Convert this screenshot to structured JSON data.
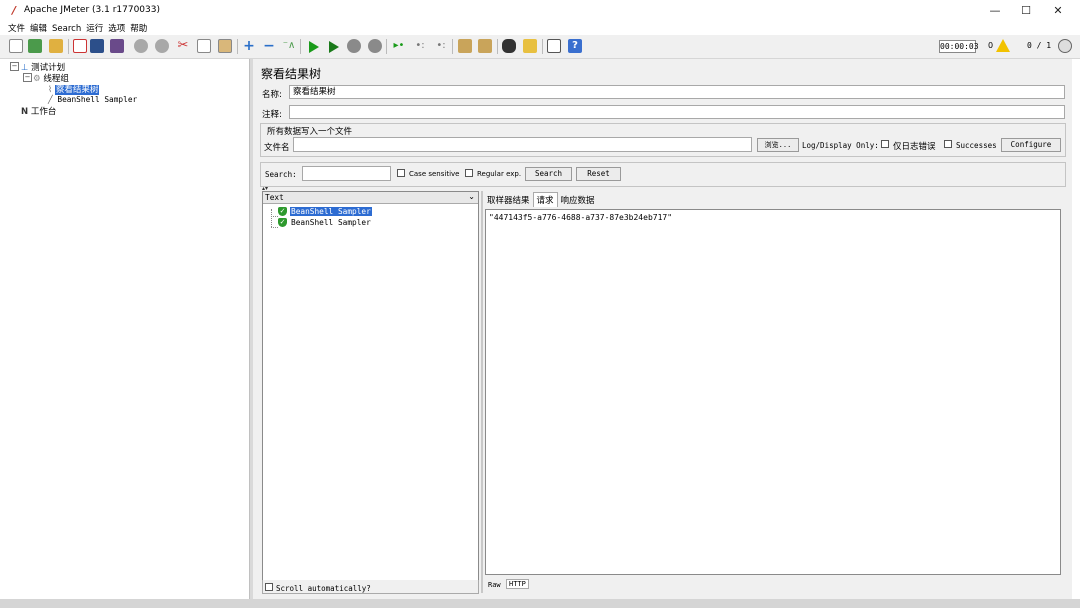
{
  "window": {
    "title": "Apache JMeter (3.1 r1770033)",
    "controls": {
      "minimize": "—",
      "maximize": "☐",
      "close": "✕"
    }
  },
  "menu": [
    "文件",
    "编辑",
    "Search",
    "运行",
    "选项",
    "帮助"
  ],
  "toolbar": {
    "timer": "00:00:03",
    "warning_count": "0",
    "threads": "0 / 1",
    "icons": [
      "new-icon",
      "templates-icon",
      "open-icon",
      "close-icon",
      "save-icon",
      "save-as-icon",
      "undo-icon",
      "redo-icon",
      "cut-icon",
      "copy-icon",
      "paste-icon",
      "expand-icon",
      "collapse-icon",
      "toggle-icon",
      "start-icon",
      "start-no-pause-icon",
      "stop-icon",
      "shutdown-icon",
      "remote-start-icon",
      "remote-stop-icon",
      "remote-shutdown-icon",
      "clear-icon",
      "clear-all-icon",
      "search-icon",
      "reset-search-icon",
      "function-helper-icon",
      "help-icon"
    ]
  },
  "tree": {
    "test_plan": "测试计划",
    "thread_group": "线程组",
    "view_results_tree": "察看结果树",
    "beanshell_sampler": "BeanShell Sampler",
    "workbench": "工作台"
  },
  "panel": {
    "title": "察看结果树",
    "name_label": "名称:",
    "name_value": "察看结果树",
    "comments_label": "注释:",
    "comments_value": "",
    "file_group_title": "所有数据写入一个文件",
    "filename_label": "文件名",
    "filename_value": "",
    "browse_label": "浏览...",
    "log_display_label": "Log/Display Only:",
    "errors_label": "仅日志错误",
    "successes_label": "Successes",
    "configure_label": "Configure"
  },
  "search": {
    "label": "Search:",
    "value": "",
    "case_sensitive_label": "Case sensitive",
    "regular_exp_label": "Regular exp.",
    "search_button": "Search",
    "reset_button": "Reset"
  },
  "results": {
    "renderer_selected": "Text",
    "samples": [
      "BeanShell Sampler",
      "BeanShell Sampler"
    ],
    "scroll_auto_label": "Scroll automatically?",
    "tabs": [
      "取样器结果",
      "请求",
      "响应数据"
    ],
    "active_tab": "请求",
    "request_content": "\"447143f5-a776-4688-a737-87e3b24eb717\"",
    "sub_tabs": [
      "Raw",
      "HTTP"
    ]
  },
  "colors": {
    "selection": "#2d6cd2",
    "success_icon": "#2e9a2e",
    "start_icon": "#1a9b1a",
    "stop_icon": "#8a8a8a",
    "warning": "#f2c200"
  }
}
